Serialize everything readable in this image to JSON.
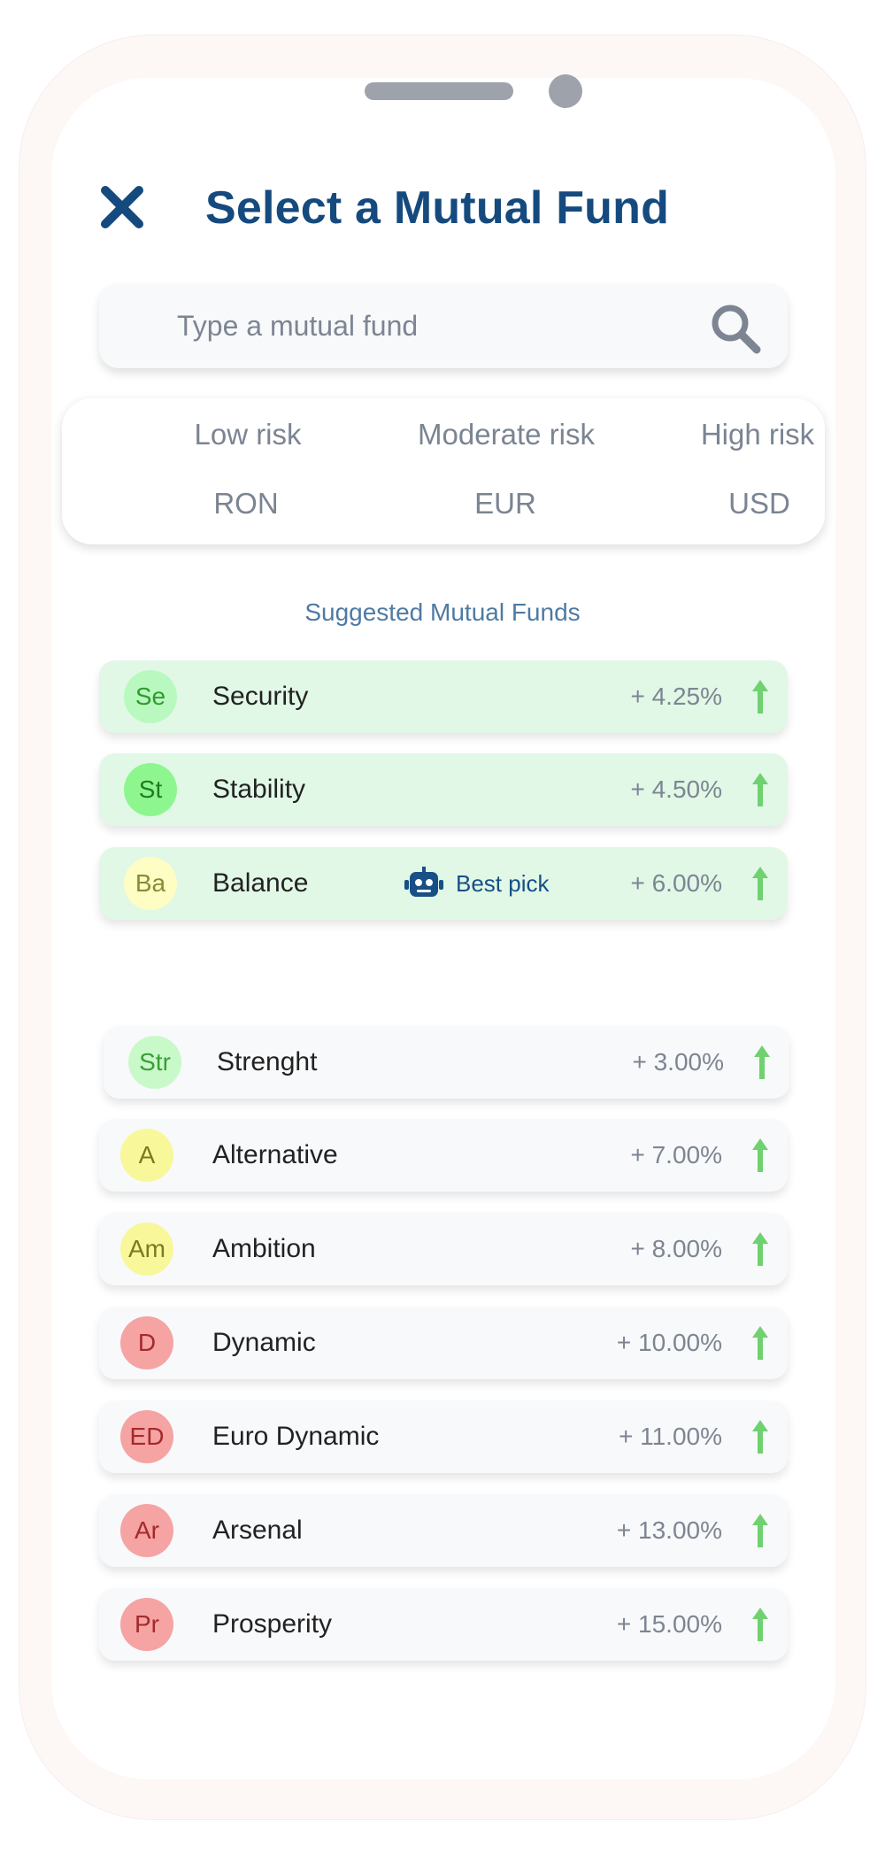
{
  "header": {
    "title": "Select a Mutual Fund"
  },
  "search": {
    "placeholder": "Type a mutual fund",
    "value": ""
  },
  "filters": {
    "risk": [
      "Low risk",
      "Moderate risk",
      "High risk"
    ],
    "currency": [
      "RON",
      "EUR",
      "USD"
    ]
  },
  "suggested": {
    "title": "Suggested Mutual Funds",
    "best_pick_label": "Best pick",
    "items": [
      {
        "initials": "Se",
        "name": "Security",
        "rate": "+ 4.25%"
      },
      {
        "initials": "St",
        "name": "Stability",
        "rate": "+ 4.50%"
      },
      {
        "initials": "Ba",
        "name": "Balance",
        "rate": "+ 6.00%"
      }
    ]
  },
  "funds": {
    "items": [
      {
        "initials": "Str",
        "name": "Strenght",
        "rate": "+ 3.00%"
      },
      {
        "initials": "A",
        "name": "Alternative",
        "rate": "+ 7.00%"
      },
      {
        "initials": "Am",
        "name": "Ambition",
        "rate": "+ 8.00%"
      },
      {
        "initials": "D",
        "name": "Dynamic",
        "rate": "+ 10.00%"
      },
      {
        "initials": "ED",
        "name": "Euro Dynamic",
        "rate": "+ 11.00%"
      },
      {
        "initials": "Ar",
        "name": "Arsenal",
        "rate": "+ 13.00%"
      },
      {
        "initials": "Pr",
        "name": "Prosperity",
        "rate": "+ 15.00%"
      }
    ]
  },
  "colors": {
    "brand": "#154a7e",
    "suggested_bg": "#e1f8e6",
    "trend_up": "#6fd16f",
    "avatar_green": "#9df79d",
    "avatar_light_green": "#c9f9c9",
    "avatar_yellow": "#f8f89a",
    "avatar_pale_yellow": "#fdfdc4",
    "avatar_red": "#f5a3a3"
  },
  "icons": {
    "close": "close-icon",
    "search": "search-icon",
    "trend": "trend-up-icon",
    "best_pick": "robot-icon"
  }
}
